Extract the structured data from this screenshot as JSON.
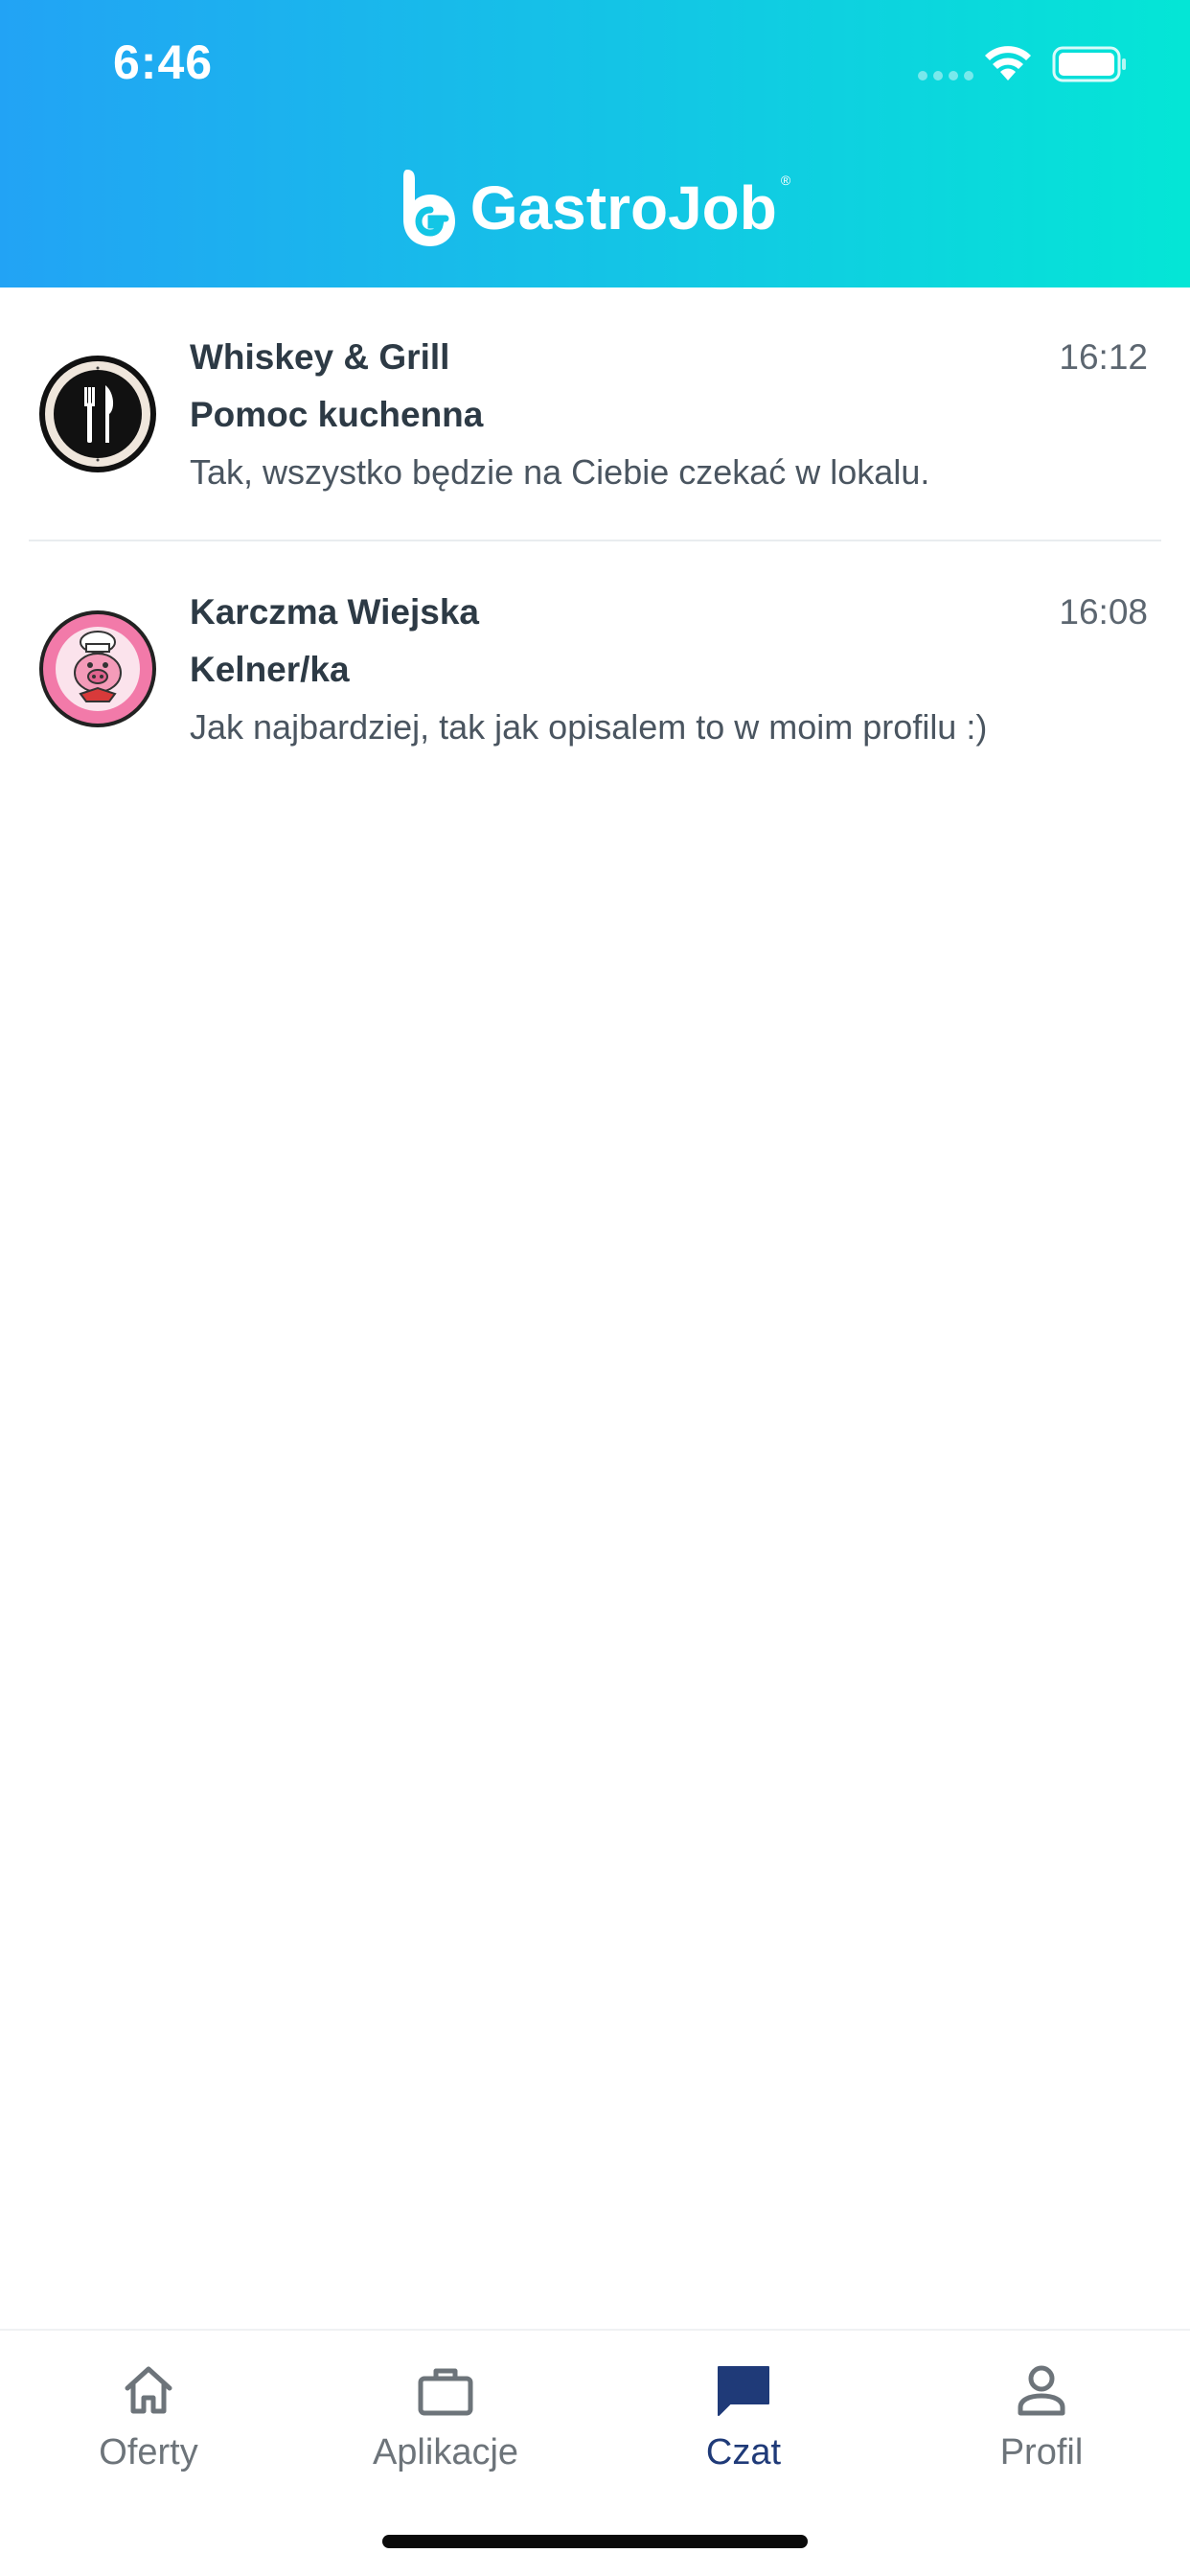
{
  "status_bar": {
    "time": "6:46"
  },
  "app": {
    "logo_text": "GastroJob",
    "logo_mark": "registered-mark",
    "brand_colors": {
      "gradient_start": "#22a3f5",
      "gradient_end": "#04e6d6",
      "active_tab": "#1f3a78"
    }
  },
  "chats": [
    {
      "name": "Whiskey & Grill",
      "job": "Pomoc kuchenna",
      "message": "Tak, wszystko będzie na Ciebie czekać w lokalu.",
      "time": "16:12",
      "avatar": "restaurant-fork-knife-logo"
    },
    {
      "name": "Karczma Wiejska",
      "job": "Kelner/ka",
      "message": "Jak najbardziej, tak jak opisalem to w moim profilu :)",
      "time": "16:08",
      "avatar": "chef-pig-logo"
    }
  ],
  "tabs": [
    {
      "label": "Oferty",
      "icon": "home-icon",
      "active": false
    },
    {
      "label": "Aplikacje",
      "icon": "briefcase-icon",
      "active": false
    },
    {
      "label": "Czat",
      "icon": "chat-bubble-icon",
      "active": true
    },
    {
      "label": "Profil",
      "icon": "person-icon",
      "active": false
    }
  ]
}
